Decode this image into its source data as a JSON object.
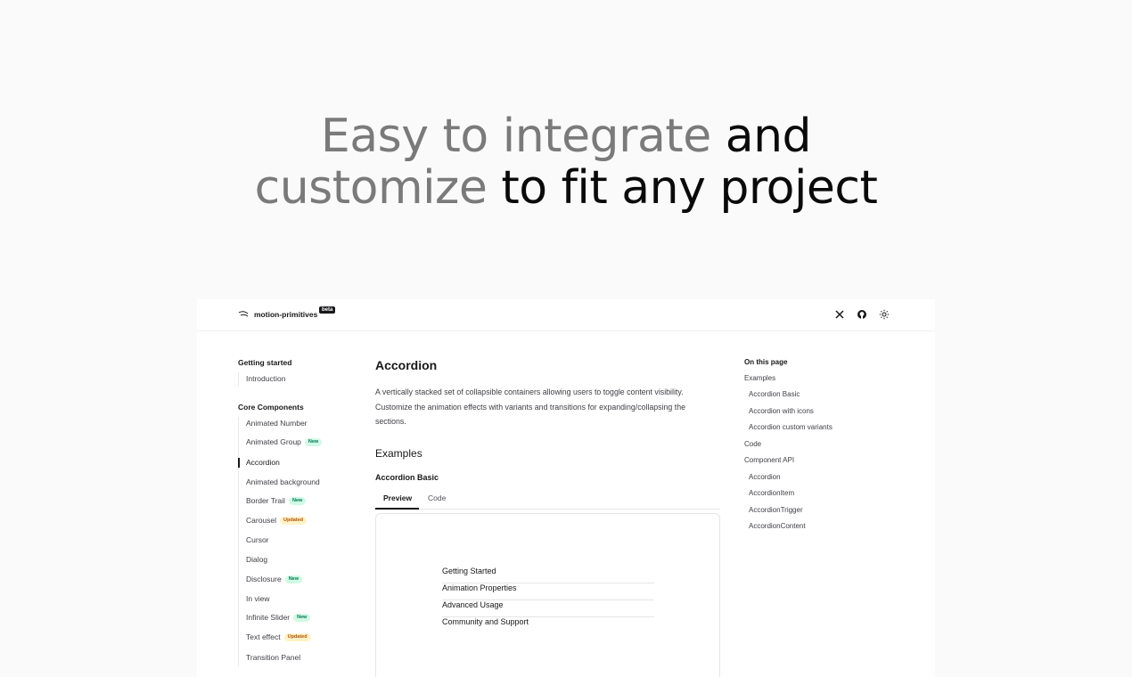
{
  "hero": {
    "line1_muted": "Easy to integrate",
    "line1_dark": "and",
    "line2_muted": "customize",
    "line2_dark": "to fit any project"
  },
  "topbar": {
    "brand": "motion-primitives",
    "badge": "beta",
    "icons": [
      "x-icon",
      "github-icon",
      "sun-icon"
    ]
  },
  "sidebar": {
    "sections": [
      {
        "title": "Getting started",
        "items": [
          {
            "label": "Introduction"
          }
        ]
      },
      {
        "title": "Core Components",
        "items": [
          {
            "label": "Animated Number"
          },
          {
            "label": "Animated Group",
            "badge": "New"
          },
          {
            "label": "Accordion",
            "active": true
          },
          {
            "label": "Animated background"
          },
          {
            "label": "Border Trail",
            "badge": "New"
          },
          {
            "label": "Carousel",
            "badge": "Updated"
          },
          {
            "label": "Cursor"
          },
          {
            "label": "Dialog"
          },
          {
            "label": "Disclosure",
            "badge": "New"
          },
          {
            "label": "In view"
          },
          {
            "label": "Infinite Slider",
            "badge": "New"
          },
          {
            "label": "Text effect",
            "badge": "Updated"
          },
          {
            "label": "Transition Panel"
          }
        ]
      }
    ]
  },
  "main": {
    "title": "Accordion",
    "description": "A vertically stacked set of collapsible containers allowing users to toggle content visibility. Customize the animation effects with variants and transitions for expanding/collapsing the sections.",
    "examples_heading": "Examples",
    "example_title": "Accordion Basic",
    "tabs": [
      "Preview",
      "Code"
    ],
    "accordion_items": [
      "Getting Started",
      "Animation Properties",
      "Advanced Usage",
      "Community and Support"
    ]
  },
  "toc": {
    "title": "On this page",
    "items": [
      {
        "label": "Examples",
        "indent": 0
      },
      {
        "label": "Accordion Basic",
        "indent": 1
      },
      {
        "label": "Accordion with icons",
        "indent": 1
      },
      {
        "label": "Accordion custom variants",
        "indent": 1
      },
      {
        "label": "Code",
        "indent": 0
      },
      {
        "label": "Component API",
        "indent": 0
      },
      {
        "label": "Accordion",
        "indent": 1
      },
      {
        "label": "AccordionItem",
        "indent": 1
      },
      {
        "label": "AccordionTrigger",
        "indent": 1
      },
      {
        "label": "AccordionContent",
        "indent": 1
      }
    ]
  }
}
